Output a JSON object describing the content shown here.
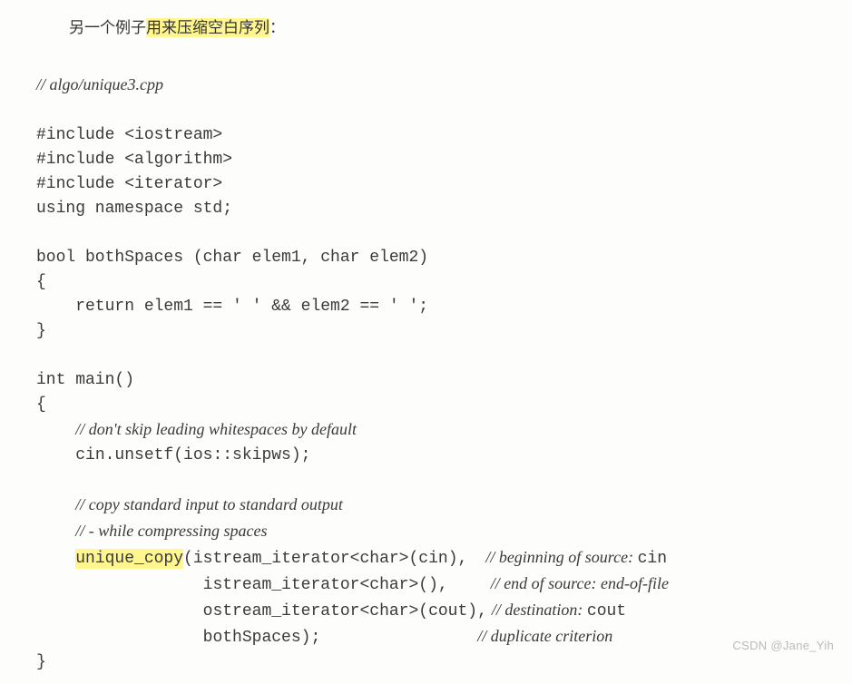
{
  "intro": {
    "prefix": "另一个例子",
    "highlight": "用来压缩空白序列",
    "suffix": "："
  },
  "filecomment": "// algo/unique3.cpp",
  "includes": [
    "#include <iostream>",
    "#include <algorithm>",
    "#include <iterator>",
    "using namespace std;"
  ],
  "func": {
    "sig": "bool bothSpaces (char elem1, char elem2)",
    "open": "{",
    "body": "    return elem1 == ' ' && elem2 == ' ';",
    "close": "}"
  },
  "main": {
    "sig": "int main()",
    "open": "{",
    "cmt1": "// don't skip leading whitespaces by default",
    "line1": "cin.unsetf(ios::skipws);",
    "cmt2a": "// copy standard input to standard output",
    "cmt2b": "// - while compressing spaces",
    "call": {
      "hl": "unique_copy",
      "l1_code": "(istream_iterator<char>(cin),",
      "l1_cmt_ital": "// beginning of source: ",
      "l1_cmt_mono": "cin",
      "l2_code": "             istream_iterator<char>(),",
      "l2_cmt": "// end of source: end-of-file",
      "l3_code": "             ostream_iterator<char>(cout),",
      "l3_cmt_ital": "// destination: ",
      "l3_cmt_mono": "cout",
      "l4_code": "             bothSpaces);",
      "l4_cmt": "// duplicate criterion"
    },
    "close": "}"
  },
  "watermark": "CSDN @Jane_Yih"
}
